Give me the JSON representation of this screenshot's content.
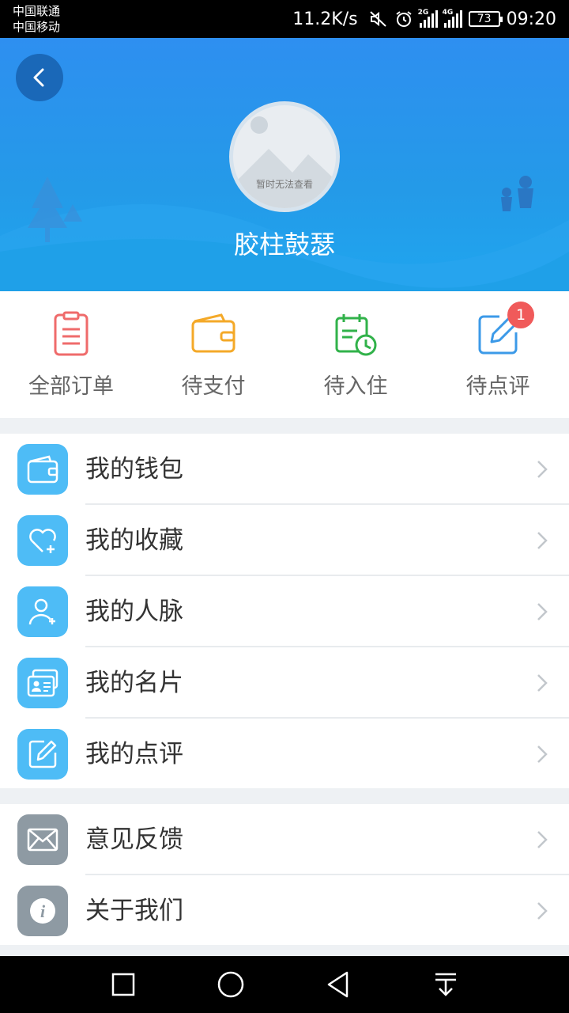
{
  "status_bar": {
    "carrier1": "中国联通",
    "carrier2": "中国移动",
    "net_speed": "11.2K/s",
    "signal1_tag": "2G",
    "signal2_tag": "4G",
    "battery": "73",
    "time": "09:20",
    "icons": [
      "mute-icon",
      "alarm-icon",
      "signal-icon",
      "battery-icon"
    ]
  },
  "header": {
    "avatar_placeholder": "暂时无法查看",
    "username": "胶柱鼓瑟",
    "colors": {
      "top": "#2e8ff0",
      "bottom": "#1fa6ef"
    }
  },
  "orders": [
    {
      "label": "全部订单",
      "icon": "clipboard-icon",
      "color": "#ef6b6b"
    },
    {
      "label": "待支付",
      "icon": "wallet-icon",
      "color": "#f4a928"
    },
    {
      "label": "待入住",
      "icon": "calendar-clock-icon",
      "color": "#31b24a"
    },
    {
      "label": "待点评",
      "icon": "edit-icon",
      "color": "#3c9ae8",
      "badge": "1"
    }
  ],
  "menu_main": [
    {
      "label": "我的钱包",
      "icon": "wallet-icon"
    },
    {
      "label": "我的收藏",
      "icon": "heart-plus-icon"
    },
    {
      "label": "我的人脉",
      "icon": "add-contact-icon"
    },
    {
      "label": "我的名片",
      "icon": "business-card-icon"
    },
    {
      "label": "我的点评",
      "icon": "edit-icon"
    }
  ],
  "menu_other": [
    {
      "label": "意见反馈",
      "icon": "envelope-icon"
    },
    {
      "label": "关于我们",
      "icon": "info-icon"
    }
  ],
  "navbar": {
    "icons": [
      "recent-apps-icon",
      "home-icon",
      "back-icon",
      "notification-pull-icon"
    ]
  }
}
